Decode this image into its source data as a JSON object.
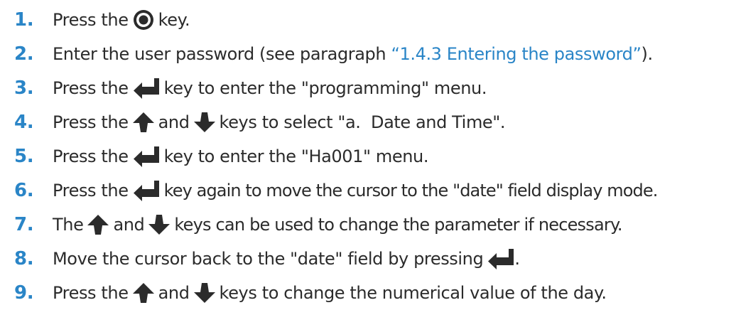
{
  "steps": [
    {
      "number": "1.",
      "parts": [
        "Press the",
        "key."
      ]
    },
    {
      "number": "2.",
      "parts": [
        "Enter the user password (see paragraph",
        "“1.4.3 Entering the password”",
        ")."
      ]
    },
    {
      "number": "3.",
      "parts": [
        "Press the",
        "key to enter the \"programming\" menu."
      ]
    },
    {
      "number": "4.",
      "parts": [
        "Press the",
        "and",
        "keys to select \"a.  Date and Time\"."
      ]
    },
    {
      "number": "5.",
      "parts": [
        "Press the",
        "key to enter the \"Ha001\" menu."
      ]
    },
    {
      "number": "6.",
      "parts": [
        "Press the",
        "key again to move the cursor to the \"date\" field display mode."
      ]
    },
    {
      "number": "7.",
      "parts": [
        "The",
        "and",
        "keys can be used to change the parameter if necessary."
      ]
    },
    {
      "number": "8.",
      "parts": [
        "Move the cursor back to the \"date\" field by pressing",
        "."
      ]
    },
    {
      "number": "9.",
      "parts": [
        "Press the",
        "and",
        "keys to change the numerical value of the day."
      ]
    }
  ],
  "icons": {
    "record": "record-key-icon",
    "enter": "enter-key-icon",
    "up": "up-arrow-key-icon",
    "down": "down-arrow-key-icon"
  },
  "colors": {
    "accent": "#2a85c7",
    "text": "#2b2b2b"
  }
}
